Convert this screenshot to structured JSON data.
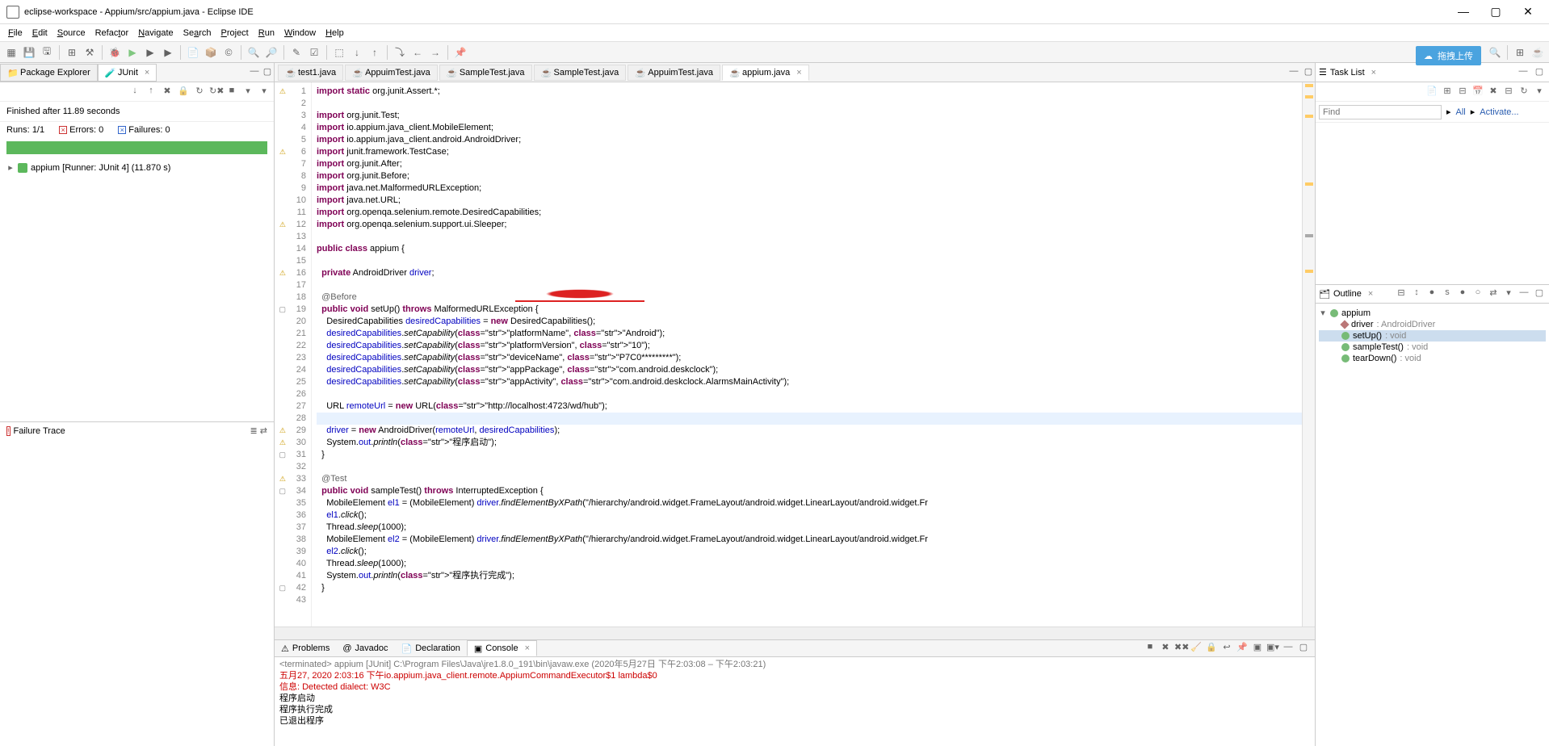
{
  "window": {
    "title": "eclipse-workspace - Appium/src/appium.java - Eclipse IDE"
  },
  "menu": {
    "items": [
      "File",
      "Edit",
      "Source",
      "Refactor",
      "Navigate",
      "Search",
      "Project",
      "Run",
      "Window",
      "Help"
    ],
    "underlines": [
      "F",
      "E",
      "S",
      "t",
      "N",
      "a",
      "P",
      "R",
      "W",
      "H"
    ]
  },
  "leftView": {
    "tab1": "Package Explorer",
    "tab2": "JUnit",
    "finished": "Finished after 11.89 seconds",
    "runsLabel": "Runs:",
    "runsVal": "1/1",
    "errorsLabel": "Errors:",
    "errorsVal": "0",
    "failLabel": "Failures:",
    "failVal": "0",
    "treeItem": "appium [Runner: JUnit 4] (11.870 s)",
    "failureTrace": "Failure Trace"
  },
  "editorTabs": {
    "t1": "test1.java",
    "t2": "AppuimTest.java",
    "t3": "SampleTest.java",
    "t4": "SampleTest.java",
    "t5": "AppuimTest.java",
    "t6": "appium.java"
  },
  "gutter": {
    "start": 1,
    "end": 43
  },
  "bottom": {
    "tab1": "Problems",
    "tab2": "Javadoc",
    "tab3": "Declaration",
    "tab4": "Console",
    "hdr": "<terminated> appium [JUnit] C:\\Program Files\\Java\\jre1.8.0_191\\bin\\javaw.exe (2020年5月27日 下午2:03:08 – 下午2:03:21)",
    "l1": "五月27, 2020 2:03:16 下午io.appium.java_client.remote.AppiumCommandExecutor$1 lambda$0",
    "l2": "信息: Detected dialect: W3C",
    "l3": "程序启动",
    "l4": "程序执行完成",
    "l5": "已退出程序"
  },
  "right": {
    "cloud": "拖拽上传",
    "taskList": "Task List",
    "find": "Find",
    "all": "All",
    "activate": "Activate...",
    "outline": "Outline",
    "class": "appium",
    "field": "driver",
    "fieldType": ": AndroidDriver",
    "m1": "setUp()",
    "m1t": ": void",
    "m2": "sampleTest()",
    "m2t": ": void",
    "m3": "tearDown()",
    "m3t": ": void"
  },
  "chart_data": {
    "type": "table",
    "title": "appium.java source code (visible portion)",
    "columns": [
      "line",
      "code"
    ],
    "rows": [
      [
        1,
        "import static org.junit.Assert.*;"
      ],
      [
        2,
        ""
      ],
      [
        3,
        "import org.junit.Test;"
      ],
      [
        4,
        "import io.appium.java_client.MobileElement;"
      ],
      [
        5,
        "import io.appium.java_client.android.AndroidDriver;"
      ],
      [
        6,
        "import junit.framework.TestCase;"
      ],
      [
        7,
        "import org.junit.After;"
      ],
      [
        8,
        "import org.junit.Before;"
      ],
      [
        9,
        "import java.net.MalformedURLException;"
      ],
      [
        10,
        "import java.net.URL;"
      ],
      [
        11,
        "import org.openqa.selenium.remote.DesiredCapabilities;"
      ],
      [
        12,
        "import org.openqa.selenium.support.ui.Sleeper;"
      ],
      [
        13,
        ""
      ],
      [
        14,
        "public class appium {"
      ],
      [
        15,
        ""
      ],
      [
        16,
        "  private AndroidDriver driver;"
      ],
      [
        17,
        ""
      ],
      [
        18,
        "  @Before"
      ],
      [
        19,
        "  public void setUp() throws MalformedURLException {"
      ],
      [
        20,
        "    DesiredCapabilities desiredCapabilities = new DesiredCapabilities();"
      ],
      [
        21,
        "    desiredCapabilities.setCapability(\"platformName\", \"Android\");"
      ],
      [
        22,
        "    desiredCapabilities.setCapability(\"platformVersion\", \"10\");"
      ],
      [
        23,
        "    desiredCapabilities.setCapability(\"deviceName\", \"P7C0*********\");"
      ],
      [
        24,
        "    desiredCapabilities.setCapability(\"appPackage\", \"com.android.deskclock\");"
      ],
      [
        25,
        "    desiredCapabilities.setCapability(\"appActivity\", \"com.android.deskclock.AlarmsMainActivity\");"
      ],
      [
        26,
        ""
      ],
      [
        27,
        "    URL remoteUrl = new URL(\"http://localhost:4723/wd/hub\");"
      ],
      [
        28,
        ""
      ],
      [
        29,
        "    driver = new AndroidDriver(remoteUrl, desiredCapabilities);"
      ],
      [
        30,
        "    System.out.println(\"程序启动\");"
      ],
      [
        31,
        "  }"
      ],
      [
        32,
        ""
      ],
      [
        33,
        "  @Test"
      ],
      [
        34,
        "  public void sampleTest() throws InterruptedException {"
      ],
      [
        35,
        "    MobileElement el1 = (MobileElement) driver.findElementByXPath(\"/hierarchy/android.widget.FrameLayout/android.widget.LinearLayout/android.widget.Fr"
      ],
      [
        36,
        "    el1.click();"
      ],
      [
        37,
        "    Thread.sleep(1000);"
      ],
      [
        38,
        "    MobileElement el2 = (MobileElement) driver.findElementByXPath(\"/hierarchy/android.widget.FrameLayout/android.widget.LinearLayout/android.widget.Fr"
      ],
      [
        39,
        "    el2.click();"
      ],
      [
        40,
        "    Thread.sleep(1000);"
      ],
      [
        41,
        "    System.out.println(\"程序执行完成\");"
      ],
      [
        42,
        "  }"
      ],
      [
        43,
        ""
      ]
    ]
  }
}
